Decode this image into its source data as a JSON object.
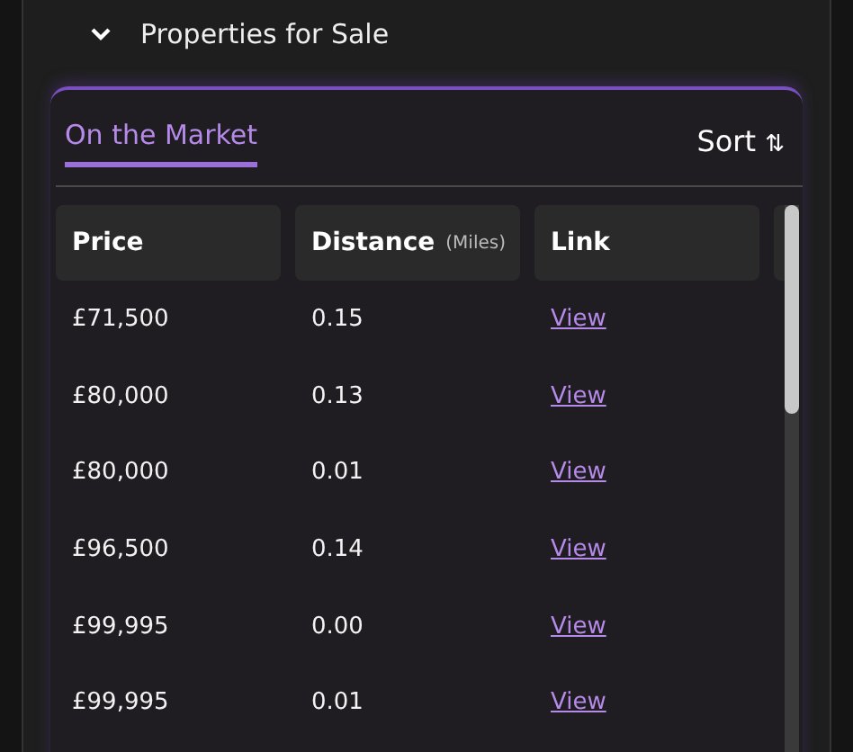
{
  "section": {
    "title": "Properties for Sale",
    "expanded": true
  },
  "tabs": [
    {
      "label": "On the Market",
      "selected": true
    }
  ],
  "sort": {
    "label": "Sort",
    "icon": "⇅"
  },
  "table": {
    "columns": [
      {
        "label": "Price"
      },
      {
        "label": "Distance",
        "unit": "(Miles)"
      },
      {
        "label": "Link"
      }
    ],
    "rows": [
      {
        "price": "£71,500",
        "distance": "0.15",
        "link": "View"
      },
      {
        "price": "£80,000",
        "distance": "0.13",
        "link": "View"
      },
      {
        "price": "£80,000",
        "distance": "0.01",
        "link": "View"
      },
      {
        "price": "£96,500",
        "distance": "0.14",
        "link": "View"
      },
      {
        "price": "£99,995",
        "distance": "0.00",
        "link": "View"
      },
      {
        "price": "£99,995",
        "distance": "0.01",
        "link": "View"
      }
    ]
  }
}
